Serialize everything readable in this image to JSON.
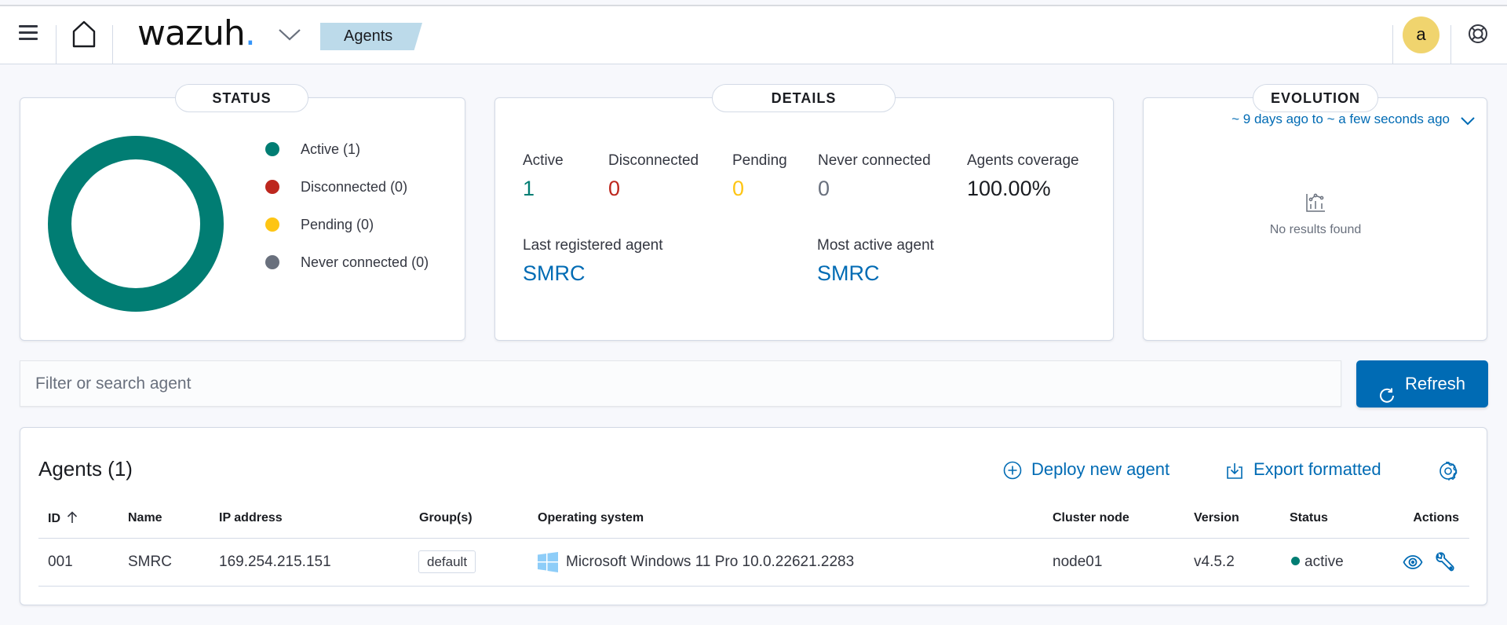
{
  "header": {
    "logo_text": "wazuh",
    "logo_dot": ".",
    "breadcrumb": "Agents",
    "avatar_letter": "a",
    "icons": {
      "menu": "hamburger-menu-icon",
      "home": "home-icon",
      "app_switcher": "chevron-down-icon",
      "help": "help-lifebuoy-icon"
    }
  },
  "status_panel": {
    "title": "STATUS",
    "legend": [
      {
        "label": "Active (1)",
        "color": "#017d73"
      },
      {
        "label": "Disconnected (0)",
        "color": "#bd271e"
      },
      {
        "label": "Pending (0)",
        "color": "#fec514"
      },
      {
        "label": "Never connected (0)",
        "color": "#69707d"
      }
    ]
  },
  "chart_data": {
    "type": "pie",
    "title": "STATUS",
    "categories": [
      "Active",
      "Disconnected",
      "Pending",
      "Never connected"
    ],
    "values": [
      1,
      0,
      0,
      0
    ],
    "colors": [
      "#017d73",
      "#bd271e",
      "#fec514",
      "#69707d"
    ],
    "donut": true,
    "legend": "right"
  },
  "details_panel": {
    "title": "DETAILS",
    "stats": [
      {
        "label": "Active",
        "value": "1",
        "color": "#017d73"
      },
      {
        "label": "Disconnected",
        "value": "0",
        "color": "#bd271e"
      },
      {
        "label": "Pending",
        "value": "0",
        "color": "#fec514"
      },
      {
        "label": "Never connected",
        "value": "0",
        "color": "#69707d"
      },
      {
        "label": "Agents coverage",
        "value": "100.00%",
        "color": "#1a1c21"
      }
    ],
    "last_registered": {
      "label": "Last registered agent",
      "value": "SMRC"
    },
    "most_active": {
      "label": "Most active agent",
      "value": "SMRC"
    }
  },
  "evolution_panel": {
    "title": "EVOLUTION",
    "time_range": "~ 9 days ago to ~ a few seconds ago",
    "empty_message": "No results found"
  },
  "search": {
    "placeholder": "Filter or search agent",
    "value": ""
  },
  "refresh_label": "Refresh",
  "agents_table": {
    "title": "Agents (1)",
    "deploy_label": "Deploy new agent",
    "export_label": "Export formatted",
    "columns": [
      "ID",
      "Name",
      "IP address",
      "Group(s)",
      "Operating system",
      "Cluster node",
      "Version",
      "Status",
      "Actions"
    ],
    "sort": {
      "column": "ID",
      "direction": "ascending"
    },
    "rows": [
      {
        "id": "001",
        "name": "SMRC",
        "ip": "169.254.215.151",
        "group": "default",
        "os": "Microsoft Windows 11 Pro 10.0.22621.2283",
        "os_icon": "windows-icon",
        "cluster_node": "node01",
        "version": "v4.5.2",
        "status": "active",
        "status_color": "#017d73"
      }
    ]
  },
  "colors": {
    "primary": "#006bb4",
    "active": "#017d73",
    "disconnected": "#bd271e",
    "pending": "#fec514",
    "never_connected": "#69707d",
    "breadcrumb_bg": "#bcdaea",
    "avatar_bg": "#f0d46e"
  }
}
